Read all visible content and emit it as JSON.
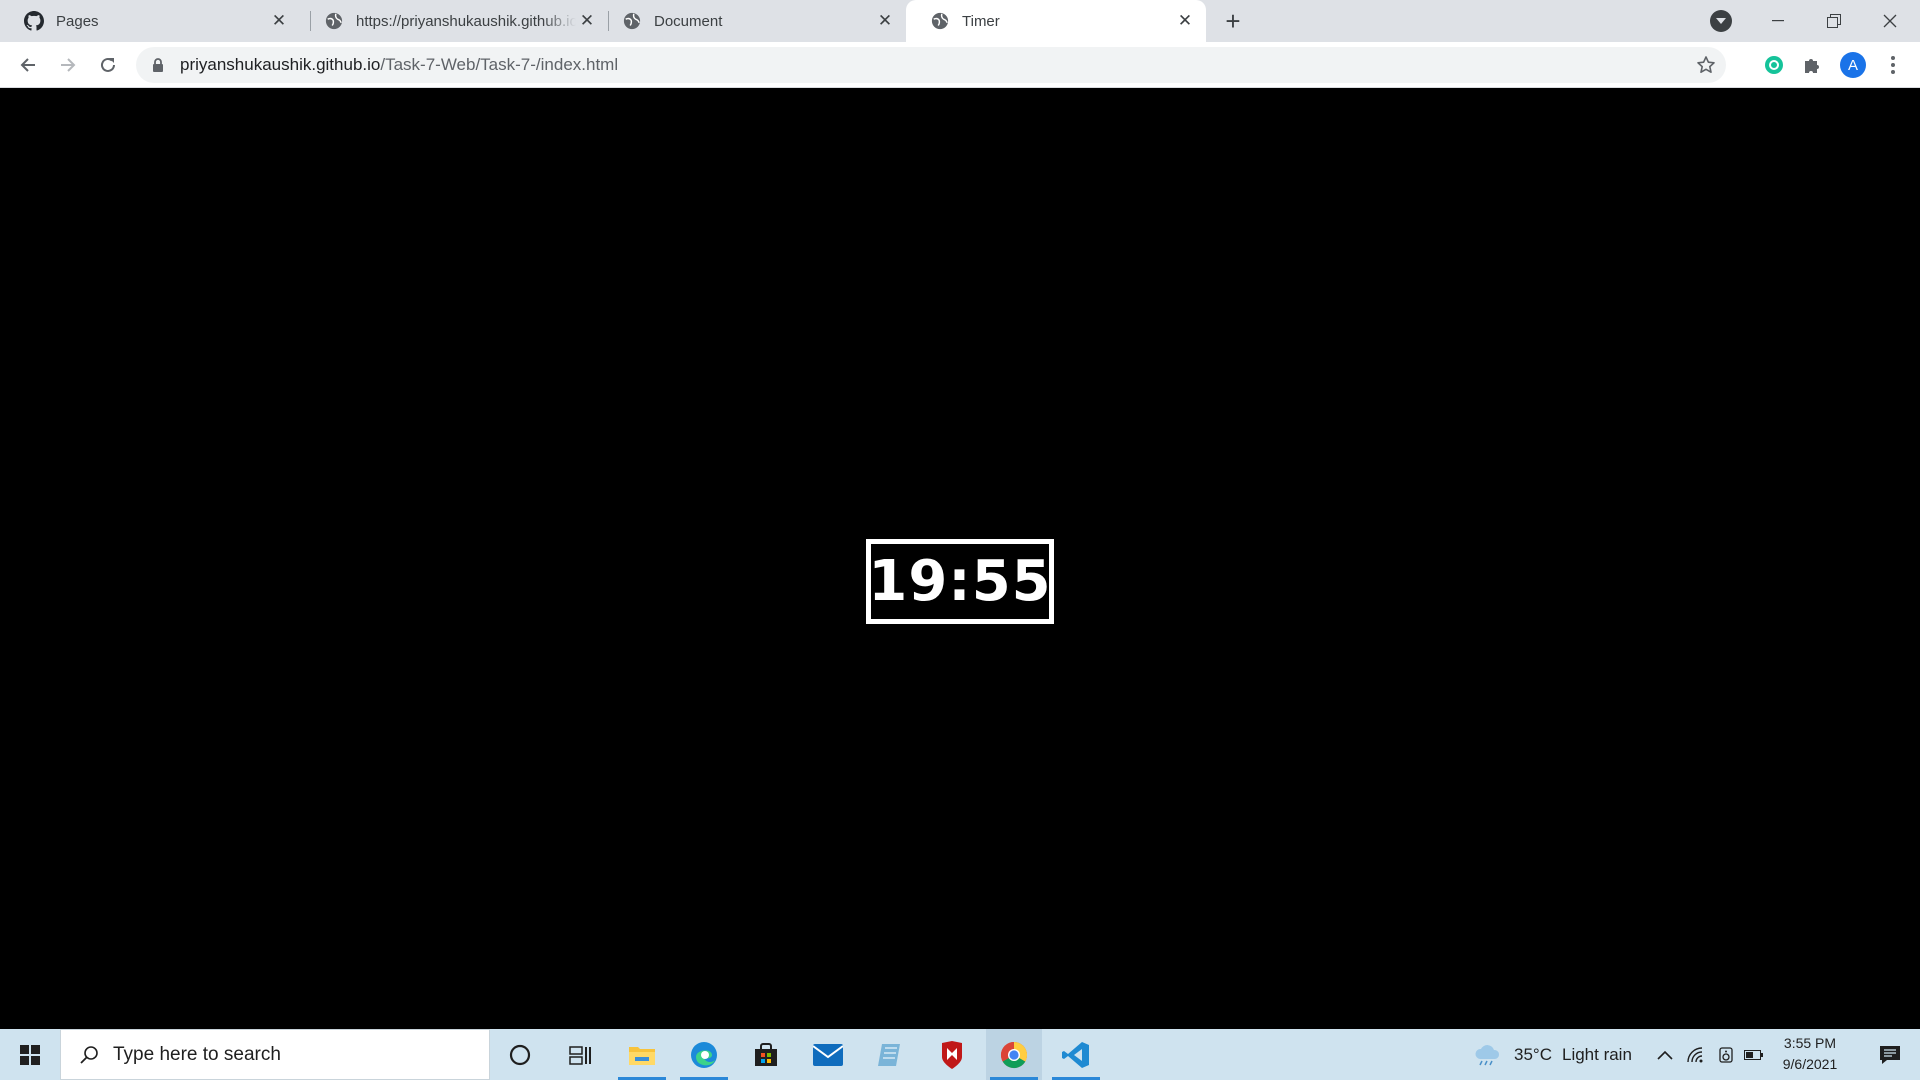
{
  "browser": {
    "tabs": [
      {
        "title": "Pages",
        "icon": "github-icon",
        "active": false
      },
      {
        "title": "https://priyanshukaushik.github.io/",
        "icon": "globe-icon",
        "active": false
      },
      {
        "title": "Document",
        "icon": "globe-icon",
        "active": false
      },
      {
        "title": "Timer",
        "icon": "globe-icon",
        "active": true
      }
    ],
    "url_host": "priyanshukaushik.github.io",
    "url_path": "/Task-7-Web/Task-7-/index.html",
    "profile_initial": "A",
    "accent": "#1a73e8"
  },
  "page": {
    "timer": "19:55",
    "background": "#000000",
    "foreground": "#ffffff"
  },
  "taskbar": {
    "search_placeholder": "Type here to search",
    "weather_temp": "35°C",
    "weather_desc": "Light rain",
    "time": "3:55 PM",
    "date": "9/6/2021",
    "pinned": [
      "cortana-icon",
      "task-view-icon",
      "file-explorer-icon",
      "edge-icon",
      "store-icon",
      "mail-icon",
      "notepad-icon",
      "mcafee-icon",
      "chrome-icon",
      "vscode-icon"
    ]
  }
}
